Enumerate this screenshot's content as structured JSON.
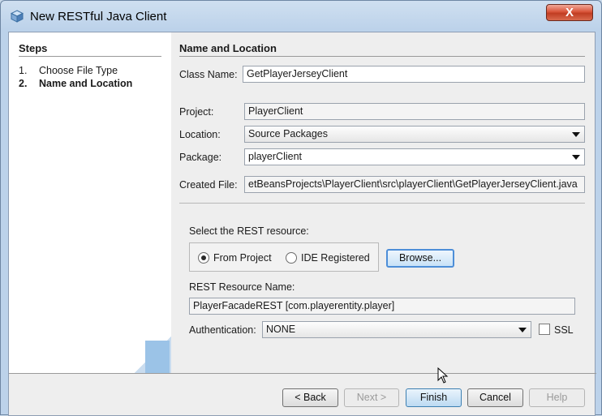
{
  "window": {
    "title": "New RESTful Java Client",
    "close_label": "X"
  },
  "steps": {
    "title": "Steps",
    "items": [
      {
        "num": "1.",
        "label": "Choose File Type"
      },
      {
        "num": "2.",
        "label": "Name and Location"
      }
    ]
  },
  "main": {
    "title": "Name and Location",
    "class_name_label": "Class Name:",
    "class_name_value": "GetPlayerJerseyClient",
    "project_label": "Project:",
    "project_value": "PlayerClient",
    "location_label": "Location:",
    "location_value": "Source Packages",
    "package_label": "Package:",
    "package_value": "playerClient",
    "created_file_label": "Created File:",
    "created_file_value": "etBeansProjects\\PlayerClient\\src\\playerClient\\GetPlayerJerseyClient.java",
    "select_resource_label": "Select the REST resource:",
    "radio_from_project": "From Project",
    "radio_ide_registered": "IDE Registered",
    "browse_label": "Browse...",
    "rest_resource_name_label": "REST Resource Name:",
    "rest_resource_name_value": "PlayerFacadeREST [com.playerentity.player]",
    "authentication_label": "Authentication:",
    "authentication_value": "NONE",
    "ssl_label": "SSL"
  },
  "footer": {
    "back_label": "< Back",
    "next_label": "Next >",
    "finish_label": "Finish",
    "cancel_label": "Cancel",
    "help_label": "Help"
  }
}
